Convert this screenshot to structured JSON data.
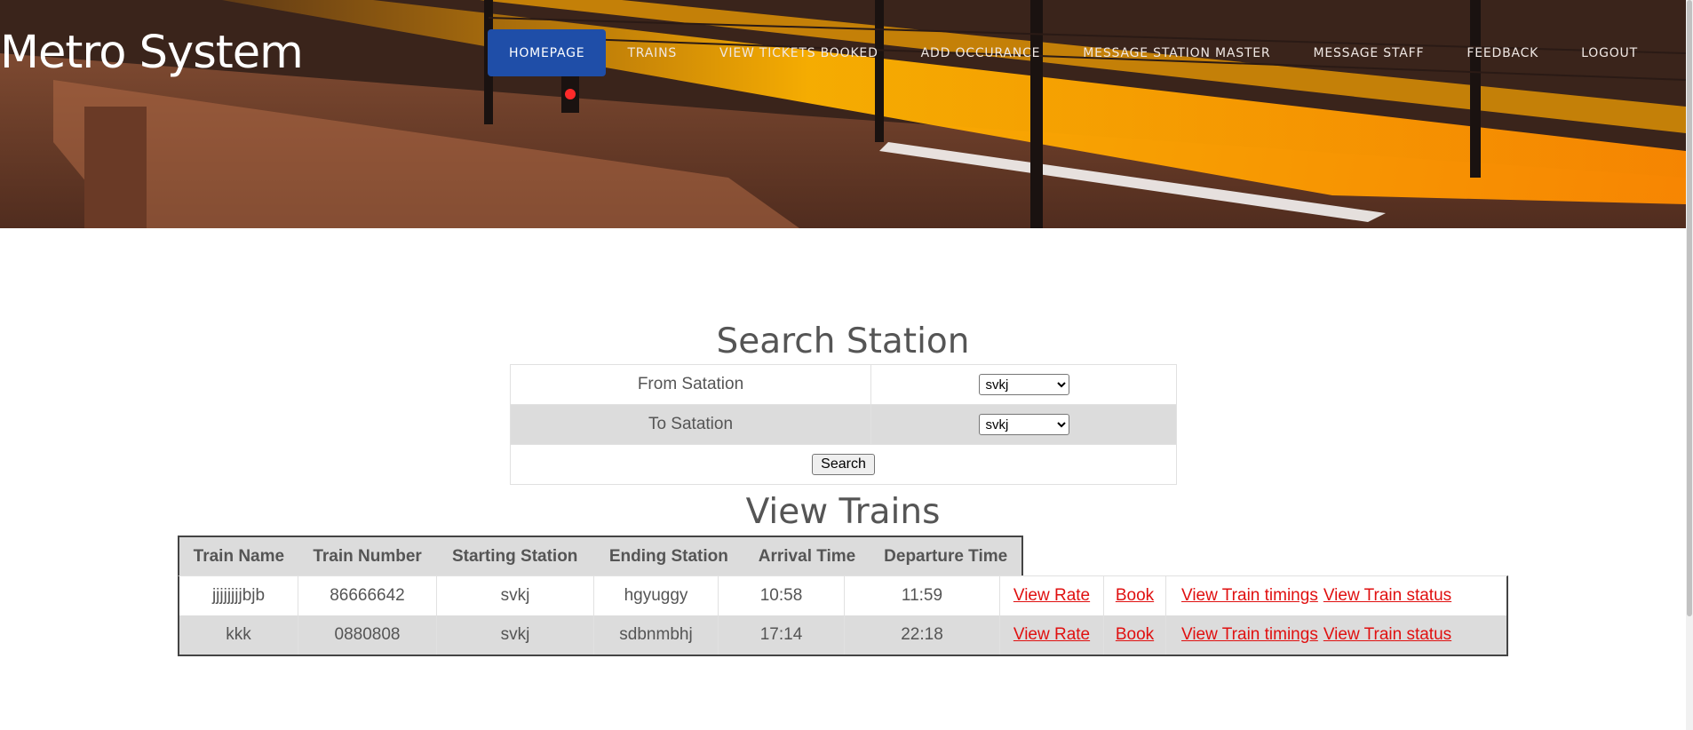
{
  "header": {
    "brand": "Metro System",
    "nav": [
      {
        "label": "Homepage",
        "active": true
      },
      {
        "label": "Trains"
      },
      {
        "label": "View Tickets  Booked"
      },
      {
        "label": "Add Occurance"
      },
      {
        "label": "Message Station  Master"
      },
      {
        "label": "Message Staff"
      },
      {
        "label": "Feedback"
      },
      {
        "label": "Logout"
      }
    ]
  },
  "search": {
    "title": "Search Station",
    "from_label": "From Satation",
    "from_value": "svkj",
    "to_label": "To Satation",
    "to_value": "svkj",
    "button": "Search"
  },
  "trains": {
    "title": "View Trains",
    "columns": [
      "Train Name",
      "Train Number",
      "Starting Station",
      "Ending Station",
      "Arrival Time",
      "Departure Time"
    ],
    "rows": [
      {
        "name": "jjjjjjjjbjb",
        "number": "86666642",
        "start": "svkj",
        "end": "hgyuggy",
        "arrival": "10:58",
        "departure": "11:59"
      },
      {
        "name": "kkk",
        "number": "0880808",
        "start": "svkj",
        "end": "sdbnmbhj",
        "arrival": "17:14",
        "departure": "22:18"
      }
    ],
    "actions": {
      "view_rate": "View Rate",
      "book": "Book",
      "view_timings": "View Train timings",
      "view_status": "View Train status"
    }
  },
  "colors": {
    "nav_active": "#1f4ea8",
    "link": "#e01010",
    "row_alt": "#dcdcdc"
  }
}
